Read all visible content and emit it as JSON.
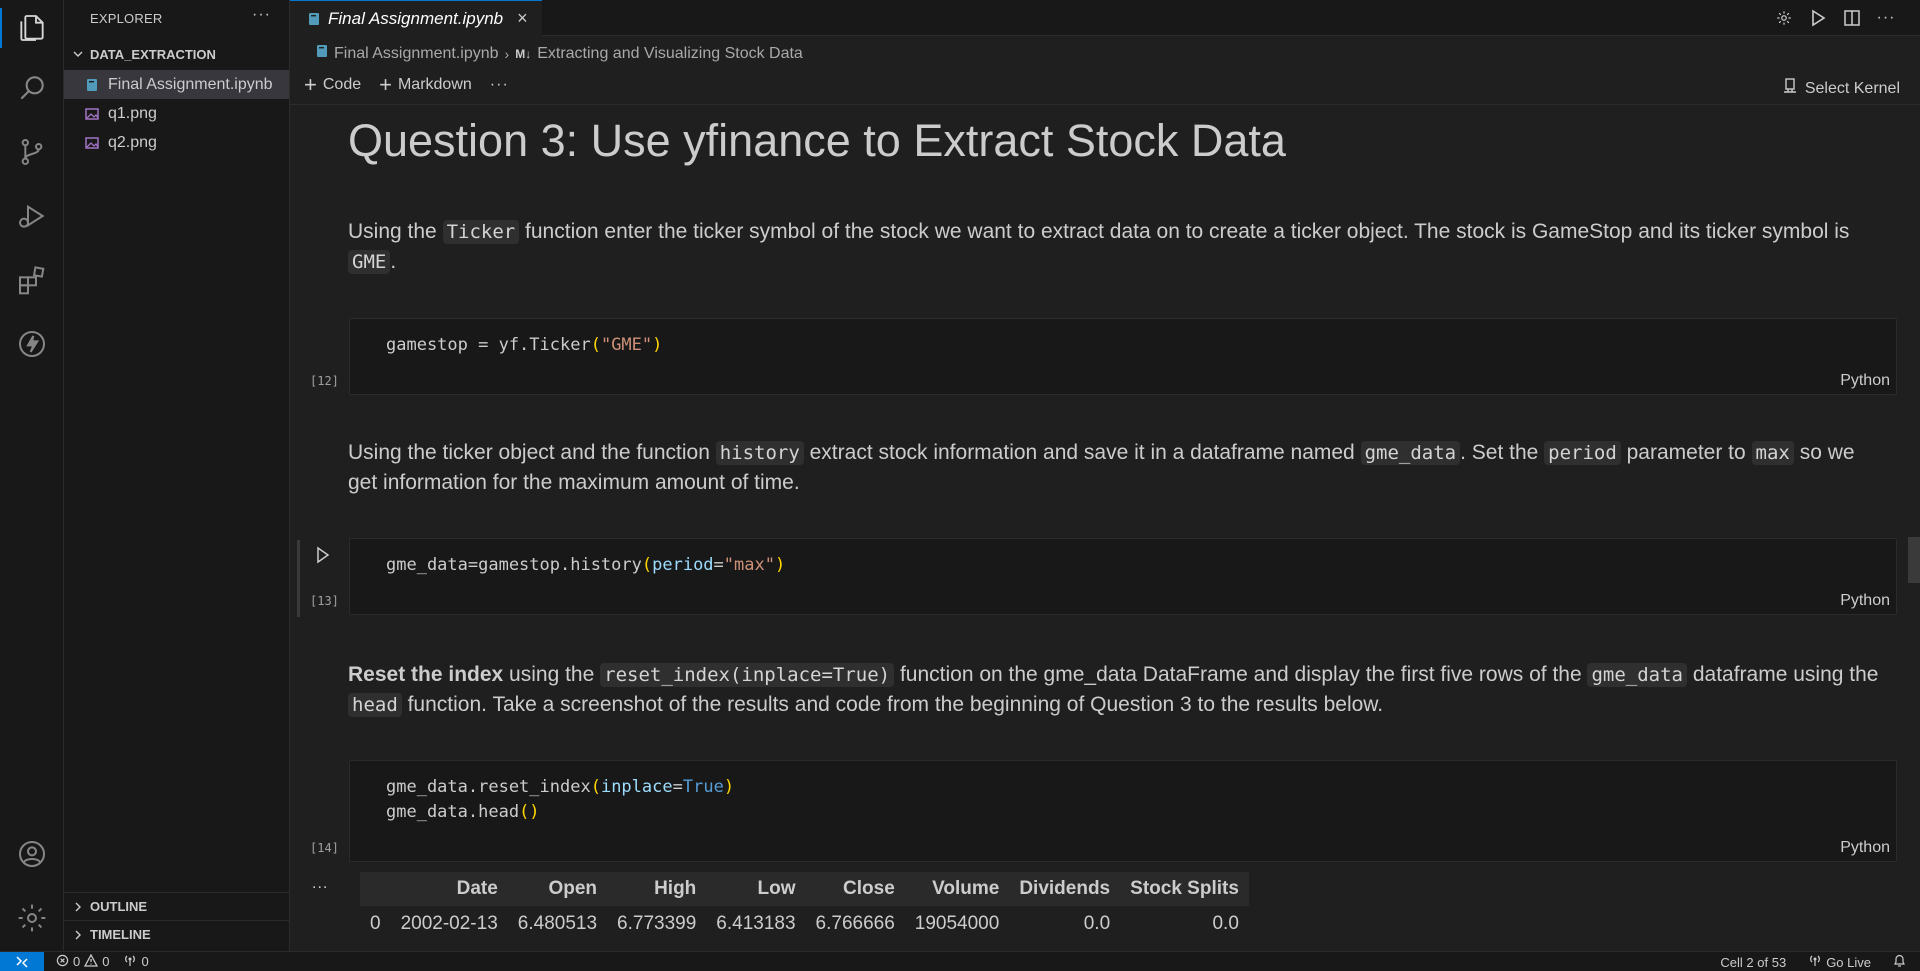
{
  "window": {
    "title": "Final Assignment.ipynb"
  },
  "sidebar": {
    "header": "EXPLORER",
    "folder": "DATA_EXTRACTION",
    "files": [
      {
        "label": "Final Assignment.ipynb",
        "icon": "notebook-icon"
      },
      {
        "label": "q1.png",
        "icon": "image-icon"
      },
      {
        "label": "q2.png",
        "icon": "image-icon"
      }
    ],
    "outline": "OUTLINE",
    "timeline": "TIMELINE"
  },
  "tab": {
    "label": "Final Assignment.ipynb"
  },
  "breadcrumb": {
    "file": "Final Assignment.ipynb",
    "section": "Extracting and Visualizing Stock Data"
  },
  "toolbar": {
    "code_label": "Code",
    "markdown_label": "Markdown",
    "kernel_label": "Select Kernel"
  },
  "notebook": {
    "heading": "Question 3: Use yfinance to Extract Stock Data",
    "para1": {
      "t1": "Using the ",
      "c1": "Ticker",
      "t2": " function enter the ticker symbol of the stock we want to extract data on to create a ticker object. The stock is GameStop and its ticker symbol is ",
      "c2": "GME",
      "t3": "."
    },
    "cell12": {
      "exec": "[12]",
      "code_a": "gamestop = yf.Ticker",
      "code_b": "(",
      "code_c": "\"GME\"",
      "code_d": ")",
      "lang": "Python"
    },
    "para2": {
      "t1": "Using the ticker object and the function ",
      "c1": "history",
      "t2": " extract stock information and save it in a dataframe named ",
      "c2": "gme_data",
      "t3": ". Set the ",
      "c3": "period",
      "t4": " parameter to ",
      "c4": "max",
      "t5": " so we get information for the maximum amount of time."
    },
    "cell13": {
      "exec": "[13]",
      "code_a": "gme_data=gamestop.history",
      "code_b": "(",
      "code_c": "period",
      "code_d": "=",
      "code_e": "\"max\"",
      "code_f": ")",
      "lang": "Python"
    },
    "para3": {
      "b1": "Reset the index",
      "t1": " using the ",
      "c1": "reset_index(inplace=True)",
      "t2": " function on the gme_data DataFrame and display the first five rows of the ",
      "c2": "gme_data",
      "t3": " dataframe using the ",
      "c3": "head",
      "t4": " function. Take a screenshot of the results and code from the beginning of Question 3 to the results below."
    },
    "cell14": {
      "exec": "[14]",
      "l1a": "gme_data.reset_index",
      "l1b": "(",
      "l1c": "inplace",
      "l1d": "=",
      "l1e": "True",
      "l1f": ")",
      "l2a": "gme_data.head",
      "l2b": "()",
      "lang": "Python"
    },
    "output": {
      "more": "...",
      "columns": [
        "",
        "Date",
        "Open",
        "High",
        "Low",
        "Close",
        "Volume",
        "Dividends",
        "Stock Splits"
      ],
      "rows": [
        [
          "0",
          "2002-02-13",
          "6.480513",
          "6.773399",
          "6.413183",
          "6.766666",
          "19054000",
          "0.0",
          "0.0"
        ]
      ]
    }
  },
  "statusbar": {
    "errors": "0",
    "warnings": "0",
    "ports": "0",
    "cell_position": "Cell 2 of 53",
    "golive": "Go Live"
  },
  "colors": {
    "accent": "#0078d4",
    "background": "#1f1f1f",
    "sidebar": "#181818"
  }
}
